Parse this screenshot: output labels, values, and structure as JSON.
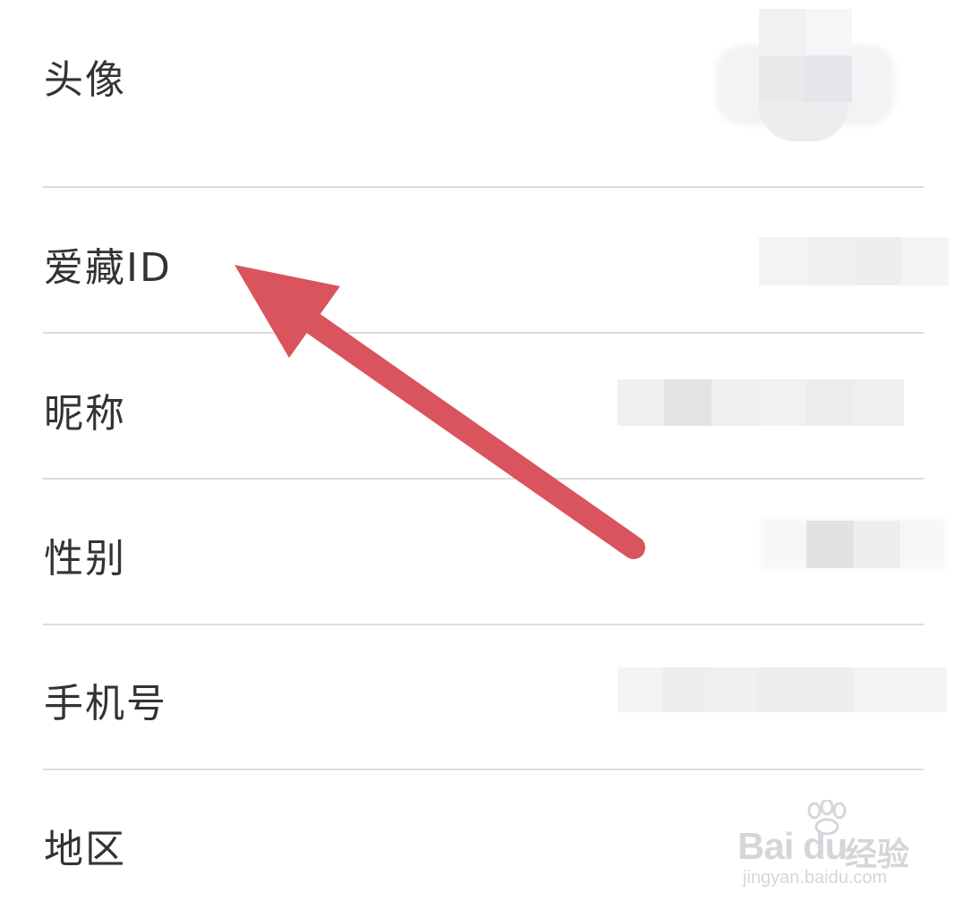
{
  "profile": {
    "rows": [
      {
        "label": "头像"
      },
      {
        "label": "爱藏ID"
      },
      {
        "label": "昵称"
      },
      {
        "label": "性别"
      },
      {
        "label": "手机号"
      },
      {
        "label": "地区"
      }
    ]
  },
  "annotation": {
    "arrow_color": "#d9545d"
  },
  "watermark": {
    "logo_text": "Bai du",
    "name": "经验",
    "url": "jingyan.baidu.com"
  }
}
